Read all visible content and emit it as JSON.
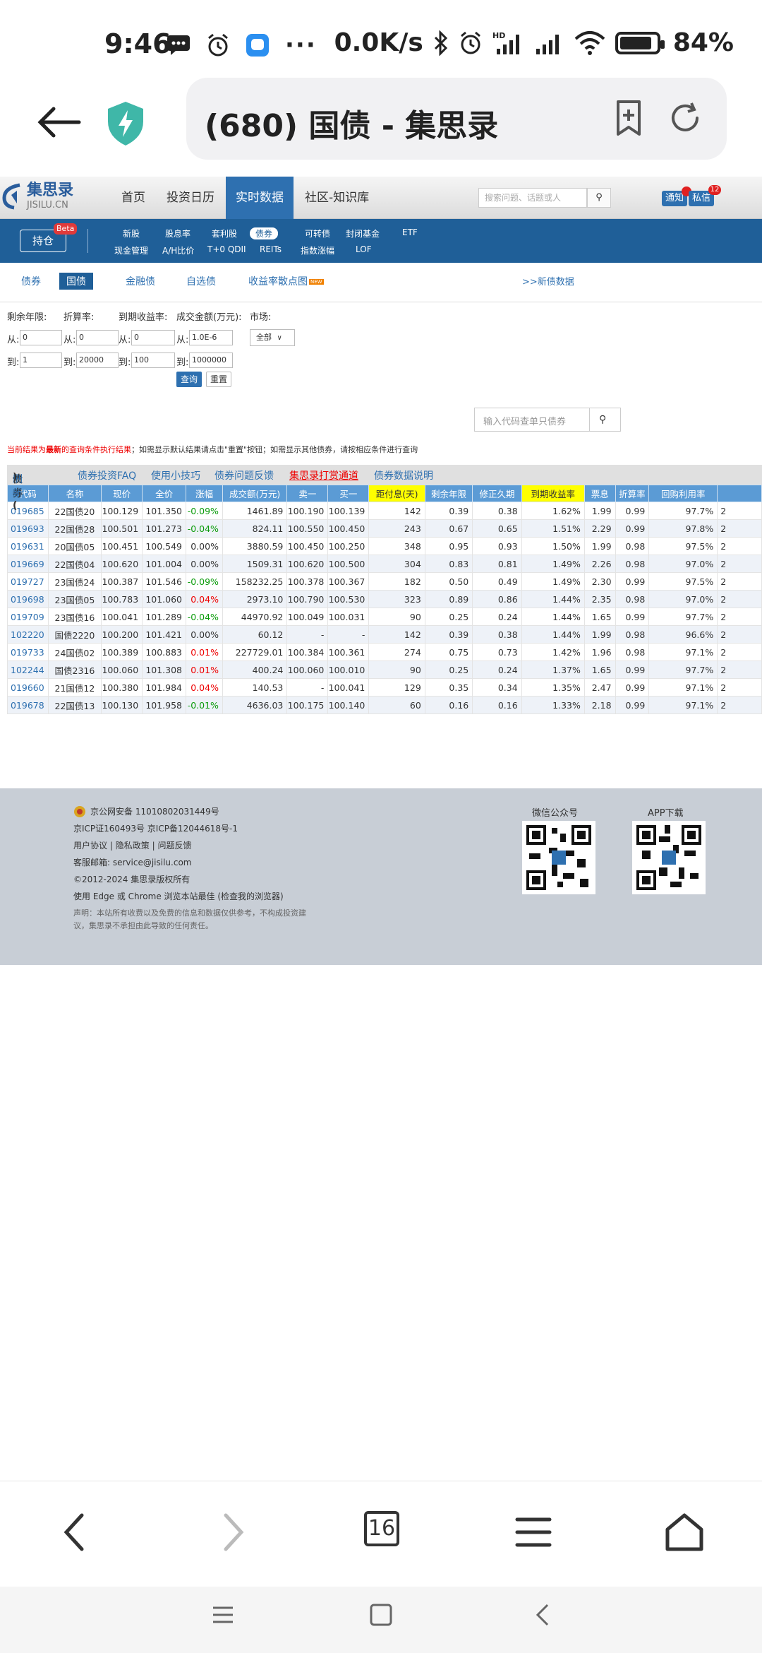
{
  "status_bar": {
    "time": "9:46",
    "net_speed": "0.0K/s",
    "battery": "84%"
  },
  "browser": {
    "url_title": "(680) 国债 - 集思录",
    "tab_count": "16"
  },
  "site_nav": {
    "logo_cn": "集思录",
    "logo_en": "JISILU.CN",
    "items": [
      "首页",
      "投资日历",
      "实时数据",
      "社区-知识库"
    ],
    "search_placeholder": "搜索问题、话题或人",
    "notify": "通知",
    "msg": "私信",
    "msg_count": "12"
  },
  "sub_nav": {
    "hold": "持仓",
    "beta": "Beta",
    "row1": [
      "新股",
      "股息率",
      "套利股",
      "债券",
      "可转债",
      "封闭基金",
      "ETF"
    ],
    "row2": [
      "现金管理",
      "A/H比价",
      "T+0 QDII",
      "REITs",
      "指数涨幅",
      "LOF"
    ]
  },
  "bond_tabs": {
    "items": [
      "债券",
      "国债",
      "金融债",
      "自选债",
      "收益率散点图"
    ],
    "new_tag": "NEW",
    "new_bond_link": ">>新债数据"
  },
  "filters": {
    "labels": [
      "剩余年限:",
      "折算率:",
      "到期收益率:",
      "成交金额(万元):",
      "市场:"
    ],
    "from": "从:",
    "to": "到:",
    "from_values": [
      "0",
      "0",
      "0",
      "1.0E-6"
    ],
    "to_values": [
      "1",
      "20000",
      "100",
      "1000000"
    ],
    "market": "全部",
    "query": "查询",
    "reset": "重置"
  },
  "code_search": {
    "placeholder": "输入代码查单只债券"
  },
  "notice": {
    "part1": "当前结果为",
    "part2": "最新",
    "part3": "的查询条件执行结果",
    "part4": "；如需显示默认结果请点击\"重置\"按钮；如需显示其他债券，请按相应条件进行查询"
  },
  "table_title": {
    "main": "债券(",
    "refresh": "刷新",
    "close": ")",
    "links": [
      "债券投资FAQ",
      "使用小技巧",
      "债券问题反馈"
    ],
    "red": "集思录打赏通道",
    "last": "债券数据说明"
  },
  "table": {
    "headers": [
      "代码",
      "名称",
      "现价",
      "全价",
      "涨幅",
      "成交额(万元)",
      "卖一",
      "买一",
      "距付息(天)",
      "剩余年限",
      "修正久期",
      "到期收益率",
      "票息",
      "折算率",
      "回购利用率"
    ],
    "rows": [
      [
        "019685",
        "22国债20",
        "100.129",
        "101.350",
        "-0.09%",
        "1461.89",
        "100.190",
        "100.139",
        "142",
        "0.39",
        "0.38",
        "1.62%",
        "1.99",
        "0.99",
        "97.7%"
      ],
      [
        "019693",
        "22国债28",
        "100.501",
        "101.273",
        "-0.04%",
        "824.11",
        "100.550",
        "100.450",
        "243",
        "0.67",
        "0.65",
        "1.51%",
        "2.29",
        "0.99",
        "97.8%"
      ],
      [
        "019631",
        "20国债05",
        "100.451",
        "100.549",
        "0.00%",
        "3880.59",
        "100.450",
        "100.250",
        "348",
        "0.95",
        "0.93",
        "1.50%",
        "1.99",
        "0.98",
        "97.5%"
      ],
      [
        "019669",
        "22国债04",
        "100.620",
        "101.004",
        "0.00%",
        "1509.31",
        "100.620",
        "100.500",
        "304",
        "0.83",
        "0.81",
        "1.49%",
        "2.26",
        "0.98",
        "97.0%"
      ],
      [
        "019727",
        "23国债24",
        "100.387",
        "101.546",
        "-0.09%",
        "158232.25",
        "100.378",
        "100.367",
        "182",
        "0.50",
        "0.49",
        "1.49%",
        "2.30",
        "0.99",
        "97.5%"
      ],
      [
        "019698",
        "23国债05",
        "100.783",
        "101.060",
        "0.04%",
        "2973.10",
        "100.790",
        "100.530",
        "323",
        "0.89",
        "0.86",
        "1.44%",
        "2.35",
        "0.98",
        "97.0%"
      ],
      [
        "019709",
        "23国债16",
        "100.041",
        "101.289",
        "-0.04%",
        "44970.92",
        "100.049",
        "100.031",
        "90",
        "0.25",
        "0.24",
        "1.44%",
        "1.65",
        "0.99",
        "97.7%"
      ],
      [
        "102220",
        "国债2220",
        "100.200",
        "101.421",
        "0.00%",
        "60.12",
        "-",
        "-",
        "142",
        "0.39",
        "0.38",
        "1.44%",
        "1.99",
        "0.98",
        "96.6%"
      ],
      [
        "019733",
        "24国债02",
        "100.389",
        "100.883",
        "0.01%",
        "227729.01",
        "100.384",
        "100.361",
        "274",
        "0.75",
        "0.73",
        "1.42%",
        "1.96",
        "0.98",
        "97.1%"
      ],
      [
        "102244",
        "国债2316",
        "100.060",
        "101.308",
        "0.01%",
        "400.24",
        "100.060",
        "100.010",
        "90",
        "0.25",
        "0.24",
        "1.37%",
        "1.65",
        "0.99",
        "97.7%"
      ],
      [
        "019660",
        "21国债12",
        "100.380",
        "101.984",
        "0.04%",
        "140.53",
        "-",
        "100.041",
        "129",
        "0.35",
        "0.34",
        "1.35%",
        "2.47",
        "0.99",
        "97.1%"
      ],
      [
        "019678",
        "22国债13",
        "100.130",
        "101.958",
        "-0.01%",
        "4636.03",
        "100.175",
        "100.140",
        "60",
        "0.16",
        "0.16",
        "1.33%",
        "2.18",
        "0.99",
        "97.1%"
      ]
    ],
    "overflow_char": "2"
  },
  "footer": {
    "beian": "京公网安备 11010802031449号",
    "icp": "京ICP证160493号 京ICP备12044618号-1",
    "links": [
      "用户协议",
      "隐私政策",
      "问题反馈"
    ],
    "link_sep": "|",
    "email": "客服邮箱:  service@jisilu.com",
    "copyright": "©2012-2024 集思录版权所有",
    "browser_line": "使用 Edge 或 Chrome 浏览本站最佳 (检查我的浏览器)",
    "disclaimer1": "声明：本站所有收费以及免费的信息和数据仅供参考，不构成投资建",
    "disclaimer2": "议，集思录不承担由此导致的任何责任。",
    "wechat": "微信公众号",
    "app": "APP下载"
  },
  "colors": {
    "brand_blue": "#1f5f98",
    "header_blue": "#5b9bd5",
    "highlight": "#ffff00",
    "up": "#e00000",
    "down": "#0a9b0a"
  }
}
